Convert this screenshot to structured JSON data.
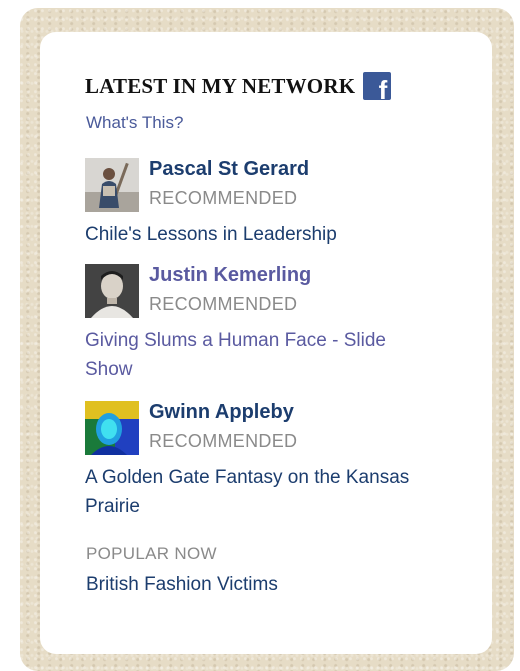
{
  "header": {
    "title": "LATEST IN MY NETWORK",
    "icon": "facebook-icon",
    "icon_glyph": "f",
    "whats_this": "What's This?"
  },
  "items": [
    {
      "name": "Pascal St Gerard",
      "tag": "RECOMMENDED",
      "story": "Chile's Lessons in Leadership"
    },
    {
      "name": "Justin Kemerling",
      "tag": "RECOMMENDED",
      "story": "Giving Slums a Human Face - Slide Show"
    },
    {
      "name": "Gwinn Appleby",
      "tag": "RECOMMENDED",
      "story": "A Golden Gate Fantasy on the Kansas Prairie"
    }
  ],
  "popular": {
    "label": "POPULAR NOW",
    "story": "British Fashion Victims"
  },
  "colors": {
    "link_navy": "#1c3d6e",
    "link_visited": "#5a5aa0",
    "facebook_blue": "#3b5998",
    "frame": "#e6dcc6"
  }
}
